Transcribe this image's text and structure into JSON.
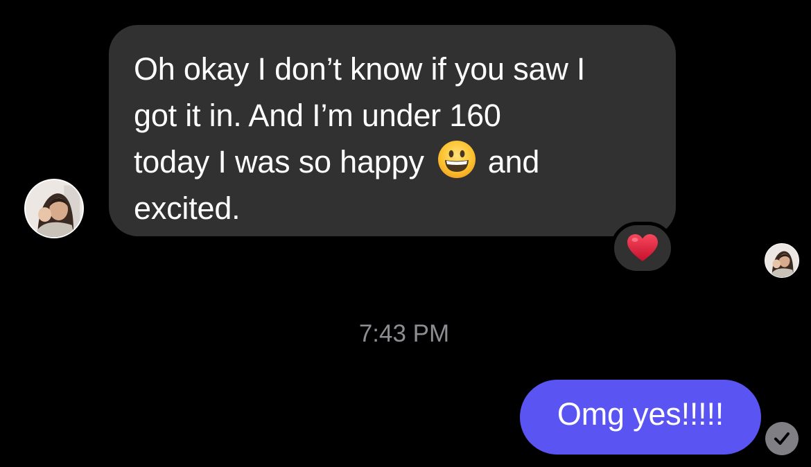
{
  "conversation": {
    "incoming_message": {
      "line1": "Oh okay I don’t know if you saw I",
      "line2": "got it in. And I’m under 160",
      "line3_before_emoji": "today I was so happy",
      "line3_after_emoji": "and",
      "line4": "excited.",
      "emoji": "grinning-face-emoji",
      "reaction": "red-heart-icon"
    },
    "timestamp": "7:43 PM",
    "outgoing_message": {
      "text": "Omg yes!!!!!"
    },
    "read_receipt_icon": "checkmark-icon"
  },
  "colors": {
    "background": "#000000",
    "incoming_bubble": "#313131",
    "outgoing_bubble": "#5a55f2",
    "timestamp_text": "#8d8d92",
    "reaction_heart": "#e0203b",
    "read_receipt": "#7f7f84"
  }
}
